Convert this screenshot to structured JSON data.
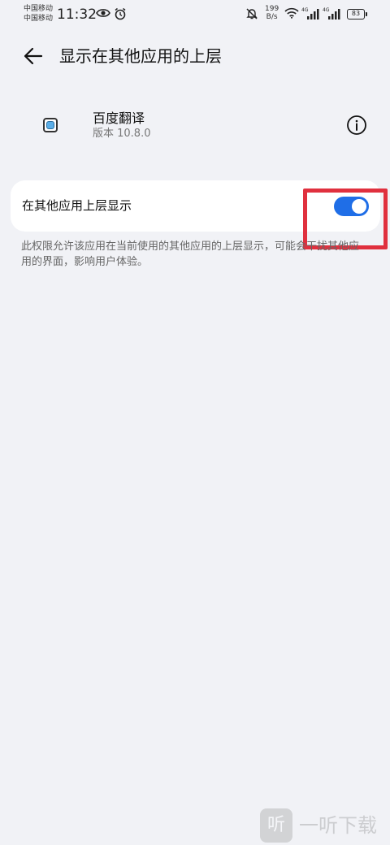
{
  "status_bar": {
    "carrier_1": "中国移动",
    "carrier_2": "中国移动",
    "time": "11:32",
    "net_speed_value": "199",
    "net_speed_unit": "B/s",
    "signal_tag_1": "4G",
    "signal_tag_2": "4G",
    "battery": "83",
    "icons": [
      "eye-icon",
      "alarm-icon",
      "mute-bell-icon",
      "wifi-icon",
      "signal-icon"
    ]
  },
  "header": {
    "title": "显示在其他应用的上层",
    "back_icon": "back-arrow-icon"
  },
  "app_info": {
    "name": "百度翻译",
    "version": "版本 10.8.0",
    "info_icon": "info-icon"
  },
  "setting": {
    "label": "在其他应用上层显示",
    "toggle_on": true,
    "accent_color": "#1f6ee7"
  },
  "description": "此权限允许该应用在当前使用的其他应用的上层显示，可能会干扰其他应用的界面，影响用户体验。",
  "annotation": {
    "highlight_color": "#e0303e"
  },
  "watermark": {
    "logo_char": "听",
    "text": "一听下载"
  }
}
